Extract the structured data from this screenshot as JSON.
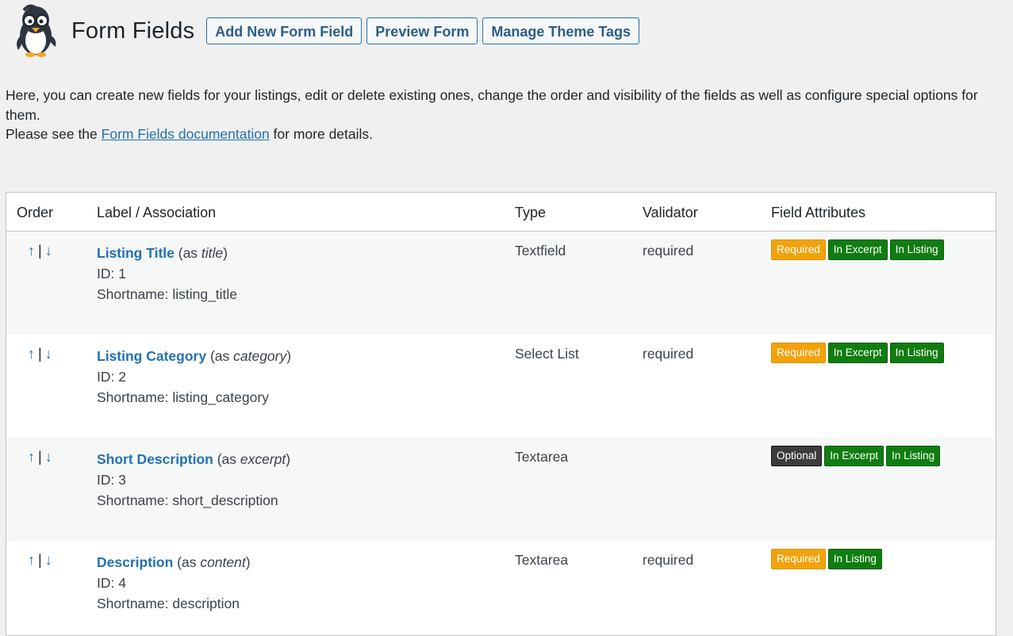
{
  "header": {
    "title": "Form Fields",
    "buttons": {
      "add_new": "Add New Form Field",
      "preview": "Preview Form",
      "manage_tags": "Manage Theme Tags"
    }
  },
  "intro": {
    "line1": "Here, you can create new fields for your listings, edit or delete existing ones, change the order and visibility of the fields as well as configure special options for them.",
    "line2_prefix": "Please see the ",
    "doc_link": "Form Fields documentation",
    "line2_suffix": " for more details."
  },
  "table": {
    "columns": {
      "order": "Order",
      "label": "Label / Association",
      "type": "Type",
      "validator": "Validator",
      "attributes": "Field Attributes"
    },
    "order_up": "↑",
    "order_sep": "|",
    "order_down": "↓",
    "rows": [
      {
        "label": "Listing Title",
        "assoc_prefix": " (as ",
        "assoc": "title",
        "assoc_suffix": ")",
        "id": "ID: 1",
        "shortname": "Shortname: listing_title",
        "type": "Textfield",
        "validator": "required",
        "badges": [
          "Required",
          "In Excerpt",
          "In Listing"
        ]
      },
      {
        "label": "Listing Category",
        "assoc_prefix": " (as ",
        "assoc": "category",
        "assoc_suffix": ")",
        "id": "ID: 2",
        "shortname": "Shortname: listing_category",
        "type": "Select List",
        "validator": "required",
        "badges": [
          "Required",
          "In Excerpt",
          "In Listing"
        ]
      },
      {
        "label": "Short Description",
        "assoc_prefix": " (as ",
        "assoc": "excerpt",
        "assoc_suffix": ")",
        "id": "ID: 3",
        "shortname": "Shortname: short_description",
        "type": "Textarea",
        "validator": "",
        "badges": [
          "Optional",
          "In Excerpt",
          "In Listing"
        ]
      },
      {
        "label": "Description",
        "assoc_prefix": " (as ",
        "assoc": "content",
        "assoc_suffix": ")",
        "id": "ID: 4",
        "shortname": "Shortname: description",
        "type": "Textarea",
        "validator": "required",
        "badges": [
          "Required",
          "In Listing"
        ]
      }
    ]
  },
  "colors": {
    "link": "#2271b1",
    "required_badge": "#f0a30a",
    "optional_badge": "#3c3c3c",
    "visibility_badge": "#0f7d0f"
  }
}
